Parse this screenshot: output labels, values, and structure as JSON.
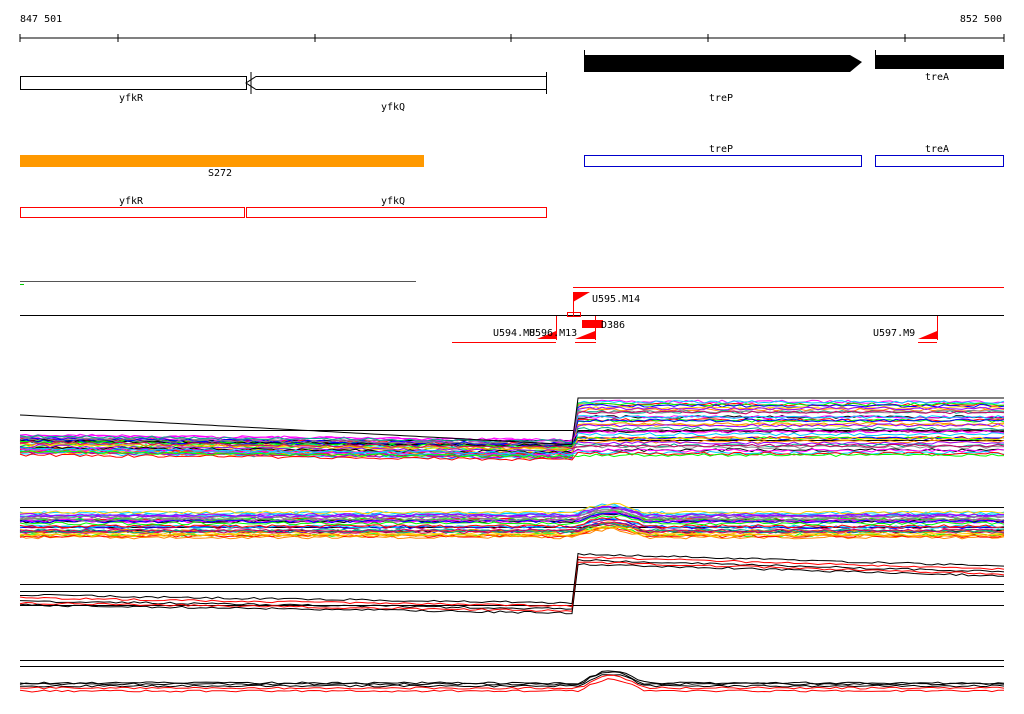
{
  "ruler": {
    "start_label": "847 501",
    "end_label": "852 500"
  },
  "genes_top": [
    {
      "name": "yfkR",
      "strand": "-"
    },
    {
      "name": "yfkQ",
      "strand": "-"
    },
    {
      "name": "treP",
      "strand": "+"
    },
    {
      "name": "treA",
      "strand": "+"
    }
  ],
  "region_label": "S272",
  "blue_genes": [
    "treP",
    "treA"
  ],
  "red_genes": [
    "yfkR",
    "yfkQ"
  ],
  "features": [
    "U595.M14",
    "D386",
    "U594.M8",
    "U596.M13",
    "U597.M9"
  ],
  "colors": {
    "orange": "#ff9900",
    "blue": "#0000cc",
    "red": "#ff0000",
    "black": "#000000"
  }
}
